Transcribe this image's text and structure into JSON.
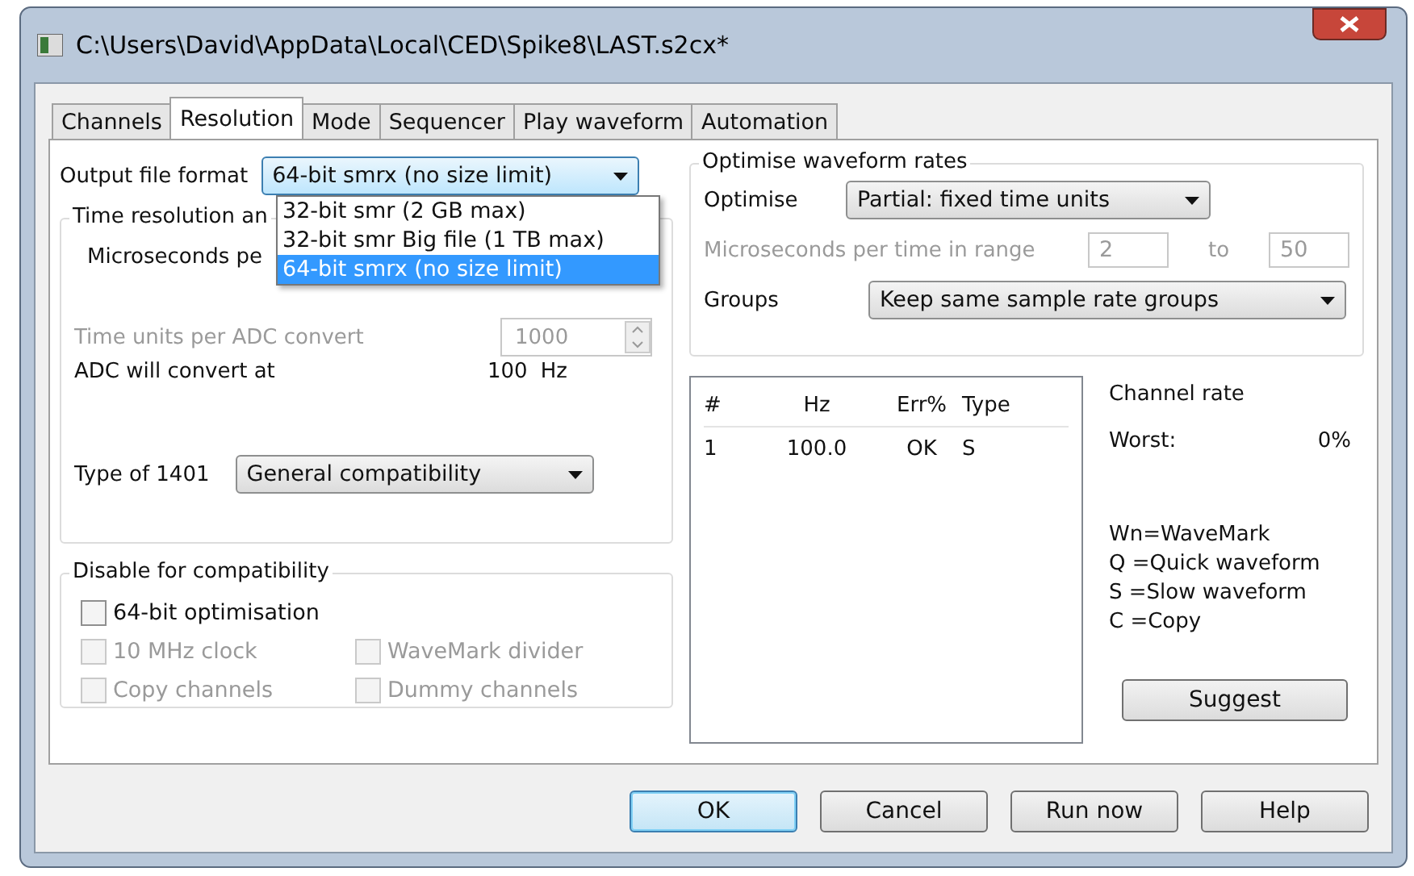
{
  "window": {
    "title": "C:\\Users\\David\\AppData\\Local\\CED\\Spike8\\LAST.s2cx*"
  },
  "tabs": [
    {
      "label": "Channels",
      "selected": false
    },
    {
      "label": "Resolution",
      "selected": true
    },
    {
      "label": "Mode",
      "selected": false
    },
    {
      "label": "Sequencer",
      "selected": false
    },
    {
      "label": "Play waveform",
      "selected": false
    },
    {
      "label": "Automation",
      "selected": false
    }
  ],
  "output_format": {
    "label": "Output file format",
    "value": "64-bit smrx (no size limit)",
    "expanded": true,
    "options": [
      {
        "label": "32-bit smr (2 GB max)",
        "selected": false
      },
      {
        "label": "32-bit smr Big file (1 TB max)",
        "selected": false
      },
      {
        "label": "64-bit smrx (no size limit)",
        "selected": true
      }
    ]
  },
  "time_group": {
    "title": "Time resolution an",
    "microseconds_label": "Microseconds pe",
    "time_units": {
      "label": "Time units per ADC convert",
      "value": "1000",
      "disabled": true
    },
    "adc": {
      "label": "ADC will convert at",
      "value": "100",
      "unit": "Hz"
    },
    "type_1401": {
      "label": "Type of 1401",
      "value": "General compatibility"
    }
  },
  "compat": {
    "title": "Disable for compatibility",
    "checkboxes": [
      {
        "label": "64-bit optimisation",
        "checked": false,
        "disabled": false
      },
      {
        "label": "10 MHz clock",
        "checked": false,
        "disabled": true
      },
      {
        "label": "WaveMark divider",
        "checked": false,
        "disabled": true
      },
      {
        "label": "Copy channels",
        "checked": false,
        "disabled": true
      },
      {
        "label": "Dummy channels",
        "checked": false,
        "disabled": true
      }
    ]
  },
  "optimise": {
    "title": "Optimise waveform rates",
    "optimise": {
      "label": "Optimise",
      "value": "Partial: fixed time units"
    },
    "range": {
      "label": "Microseconds per time in range",
      "from": "2",
      "to_label": "to",
      "to": "50",
      "disabled": true
    },
    "groups": {
      "label": "Groups",
      "value": "Keep same sample rate groups"
    }
  },
  "rates_table": {
    "columns": [
      "#",
      "Hz",
      "Err%",
      "Type"
    ],
    "rows": [
      [
        "1",
        "100.0",
        "OK",
        "S"
      ]
    ]
  },
  "channel_rate": {
    "title": "Channel rate",
    "worst_label": "Worst:",
    "worst_value": "0%"
  },
  "legend": [
    "Wn=WaveMark",
    "Q =Quick waveform",
    "S =Slow waveform",
    "C =Copy"
  ],
  "suggest_button": "Suggest",
  "buttons": [
    {
      "label": "OK",
      "default": true
    },
    {
      "label": "Cancel",
      "default": false
    },
    {
      "label": "Run now",
      "default": false
    },
    {
      "label": "Help",
      "default": false
    }
  ]
}
